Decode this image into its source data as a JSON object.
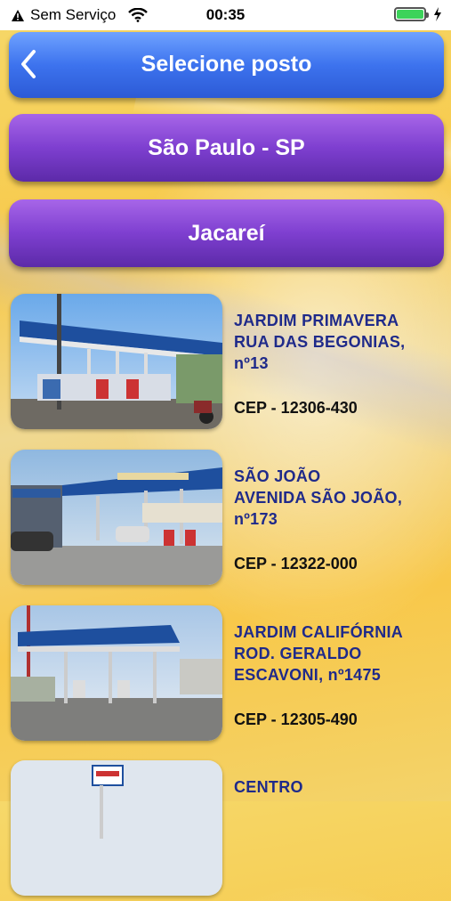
{
  "status": {
    "carrier": "Sem Serviço",
    "time": "00:35"
  },
  "nav": {
    "title": "Selecione posto"
  },
  "state": "São Paulo - SP",
  "city": "Jacareí",
  "stations": [
    {
      "name": "JARDIM PRIMAVERA",
      "address": "RUA DAS BEGONIAS, nº13",
      "cep": "CEP - 12306-430"
    },
    {
      "name": "SÃO JOÃO",
      "address": "AVENIDA SÃO JOÃO, nº173",
      "cep": "CEP - 12322-000"
    },
    {
      "name": "JARDIM CALIFÓRNIA",
      "address": "ROD. GERALDO ESCAVONI, nº1475",
      "cep": "CEP - 12305-490"
    },
    {
      "name": "CENTRO",
      "address": "",
      "cep": ""
    }
  ],
  "colors": {
    "nav_blue": "#3d73ee",
    "pill_purple": "#7e3fd0",
    "station_text": "#1f2a8a",
    "battery_green": "#3cd35a"
  }
}
